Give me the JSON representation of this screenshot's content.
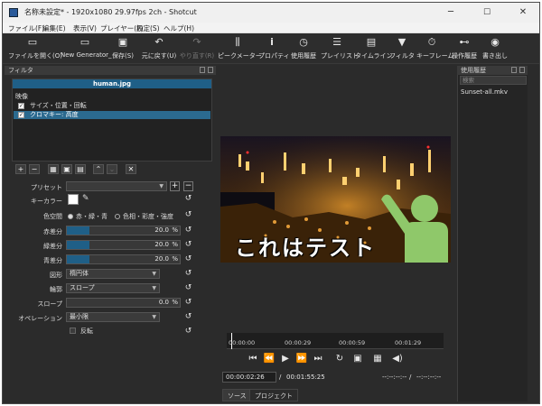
{
  "window": {
    "title": "名称未設定* - 1920x1080 29.97fps 2ch - Shotcut",
    "minimize": "─",
    "maximize": "☐",
    "close": "✕"
  },
  "menu": [
    "ファイル(F)",
    "編集(E)",
    "表示(V)",
    "プレイヤー(P)",
    "設定(S)",
    "ヘルプ(H)"
  ],
  "toolbar": [
    {
      "label": "ファイルを開く(O)",
      "icon": "folder-icon",
      "glyph": "▭",
      "enabled": true
    },
    {
      "label": "New Generator_",
      "icon": "generator-icon",
      "glyph": "▭",
      "enabled": true
    },
    {
      "label": "保存(S)",
      "icon": "save-icon",
      "glyph": "▣",
      "enabled": true
    },
    {
      "label": "元に戻す(U)",
      "icon": "undo-icon",
      "glyph": "↶",
      "enabled": true
    },
    {
      "label": "やり直す(R)",
      "icon": "redo-icon",
      "glyph": "↷",
      "enabled": false
    },
    {
      "label": "ピークメーター",
      "icon": "meter-icon",
      "glyph": "⫼",
      "enabled": true
    },
    {
      "label": "プロパティ",
      "icon": "info-icon",
      "glyph": "i",
      "enabled": true
    },
    {
      "label": "使用履歴",
      "icon": "clock-icon",
      "glyph": "◷",
      "enabled": true
    },
    {
      "label": "プレイリスト",
      "icon": "list-icon",
      "glyph": "☰",
      "enabled": true
    },
    {
      "label": "タイムライン",
      "icon": "timeline-icon",
      "glyph": "▤",
      "enabled": true
    },
    {
      "label": "フィルタ",
      "icon": "filter-icon",
      "glyph": "▼",
      "enabled": true
    },
    {
      "label": "キーフレーム",
      "icon": "stopwatch-icon",
      "glyph": "⏱",
      "enabled": true
    },
    {
      "label": "操作履歴",
      "icon": "history-icon",
      "glyph": "⊷",
      "enabled": true
    },
    {
      "label": "書き出し",
      "icon": "export-icon",
      "glyph": "◉",
      "enabled": true
    }
  ],
  "filters_panel": {
    "title": "フィルタ",
    "clip_name": "human.jpg",
    "section": "映像",
    "items": [
      {
        "label": "サイズ・位置・回転",
        "checked": true,
        "selected": false
      },
      {
        "label": "クロマキー: 高度",
        "checked": true,
        "selected": true
      }
    ],
    "buttons": [
      "add-icon",
      "remove-icon",
      "copy-icon",
      "paste-icon",
      "save-preset-icon",
      "move-up-icon",
      "move-down-icon",
      "close-icon"
    ],
    "params": {
      "preset_label": "プリセット",
      "preset_value": "",
      "key_color_label": "キーカラー",
      "key_color": "#ffffff",
      "color_space_label": "色空間",
      "color_space_options": [
        "赤・緑・青",
        "色相・彩度・強度"
      ],
      "color_space_selected": 0,
      "red_label": "赤差分",
      "red_value": "20.0",
      "red_pct": 20,
      "green_label": "緑差分",
      "green_value": "20.0",
      "green_pct": 20,
      "blue_label": "青差分",
      "blue_value": "20.0",
      "blue_pct": 20,
      "shape_label": "図形",
      "shape_value": "楕円体",
      "edge_label": "輪郭",
      "edge_value": "スロープ",
      "slope_label": "スロープ",
      "slope_value": "0.0",
      "slope_pct": 0,
      "operation_label": "オペレーション",
      "operation_value": "最小限",
      "invert_label": "反転",
      "percent": "%"
    }
  },
  "viewer": {
    "overlay_text": "これはテスト",
    "ruler_ticks": [
      "00:00:00",
      "00:00:29",
      "00:00:59",
      "00:01:29"
    ],
    "current_time": "00:00:02:26",
    "separator": "/",
    "total_time": "00:01:55:25",
    "in_point": "--:--:--:--",
    "out_point": "--:--:--:--",
    "tabs": [
      "ソース",
      "プロジェクト"
    ]
  },
  "history_panel": {
    "title": "使用履歴",
    "search_placeholder": "検索",
    "items": [
      "Sunset-all.mkv"
    ]
  }
}
